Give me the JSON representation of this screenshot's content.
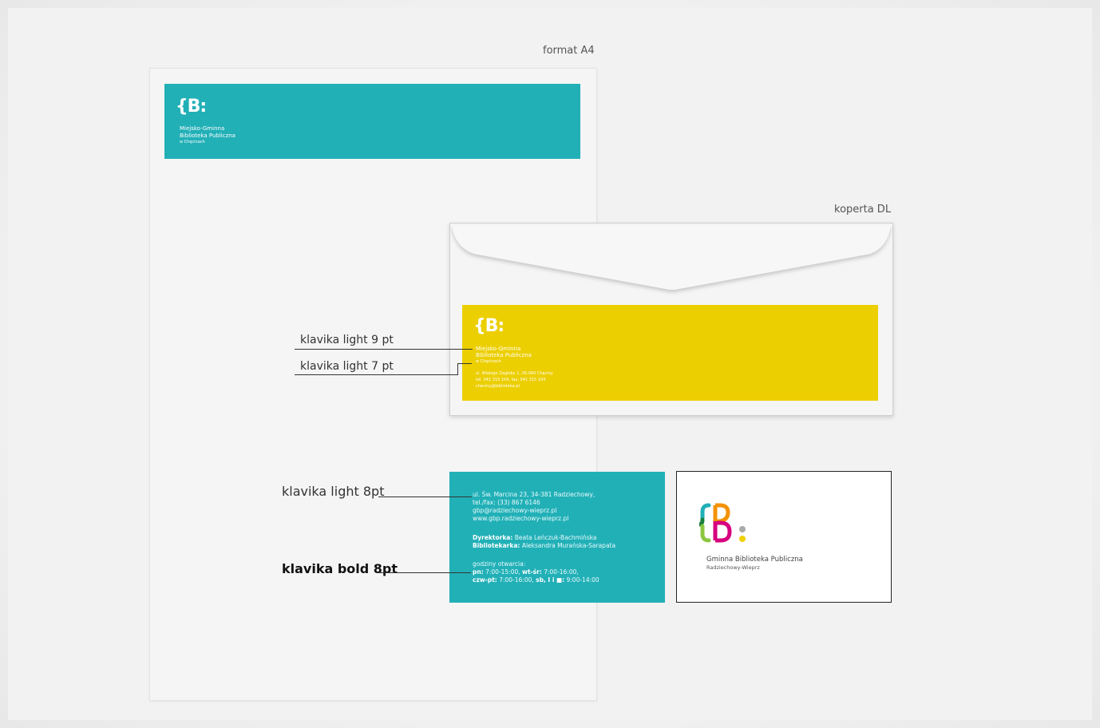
{
  "labels": {
    "format": "format A4",
    "envelope": "koperta DL"
  },
  "letterhead": {
    "logo": "{B:",
    "line1": "Miejsko-Gminna",
    "line2": "Biblioteka Publiczna",
    "line3": "w Chęcinach"
  },
  "envelope": {
    "logo": "{B:",
    "line1": "Miejsko-Gminna",
    "line2": "Biblioteka Publiczna",
    "line3": "w Chęcinach",
    "addr1": "ul. Wielego Zagłoby 1, 26-060 Chęciny",
    "addr2": "tel. 041 315 104, fax. 041 315 104",
    "addr3": "checiny@biblioteka.pl"
  },
  "annotations": {
    "light9": "klavika light 9 pt",
    "light7": "klavika light 7 pt",
    "light8": "klavika light 8pt",
    "bold8": "klavika bold 8pt"
  },
  "card_front": {
    "addr1": "ul. Św. Marcina 23, 34-381 Radziechowy,",
    "addr2": "tel./fax: (33) 867 6146",
    "addr3": "gbp@radziechowy-wieprz.pl",
    "addr4": "www.gbp.radziechowy-wieprz.pl",
    "dir_label": "Dyrektorka:",
    "dir_name": "Beata Leńczuk-Bachmińska",
    "lib_label": "Bibliotekarka:",
    "lib_name": "Aleksandra Murańska-Sarapata",
    "hours_title": "godziny otwarcia:",
    "h1_label": "pn:",
    "h1_val": "7:00-15:00,",
    "h2_label": "wt-śr:",
    "h2_val": "7:00-16:00,",
    "h3_label": "czw-pt:",
    "h3_val": "7:00-16:00,",
    "h4_label": "sb, I i ■:",
    "h4_val": "9:00-14:00"
  },
  "card_back": {
    "name": "Gminna Biblioteka Publiczna",
    "place": "Radziechowy-Wieprz"
  },
  "colors": {
    "teal": "#22b0b7",
    "yellow": "#eccf00",
    "logo_orange": "#f39200",
    "logo_teal": "#22b0b7",
    "logo_green": "#8cc63f",
    "logo_magenta": "#d6007e",
    "logo_grey": "#aaaaaa",
    "logo_yellow": "#f0d000"
  }
}
